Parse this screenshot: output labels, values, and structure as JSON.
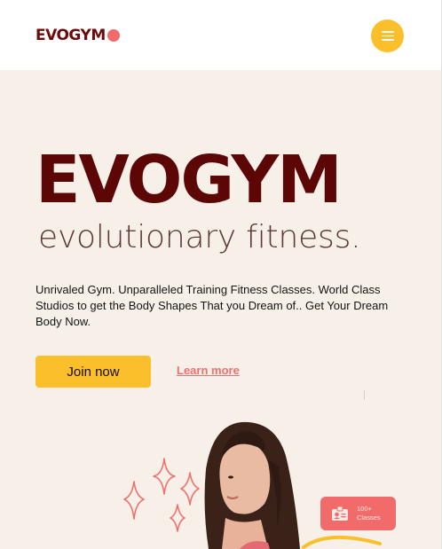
{
  "header": {
    "logo_text": "EVOGYM",
    "menu_icon": "hamburger-menu-icon"
  },
  "hero": {
    "title": "EVOGYM",
    "subtitle": "evolutionary fitness.",
    "description": "Unrivaled Gym. Unparalleled Training Fitness Classes. World Class Studios to get the Body Shapes That you Dream of.. Get Your Dream Body Now.",
    "join_label": "Join now",
    "learn_label": "Learn more"
  },
  "badge": {
    "icon": "id-card-icon",
    "count": "100+",
    "label": "Classes"
  },
  "colors": {
    "brand_dark": "#5c0606",
    "accent_yellow": "#fbbf2c",
    "accent_coral": "#f26b6b",
    "hero_bg": "#f6f0e8"
  }
}
